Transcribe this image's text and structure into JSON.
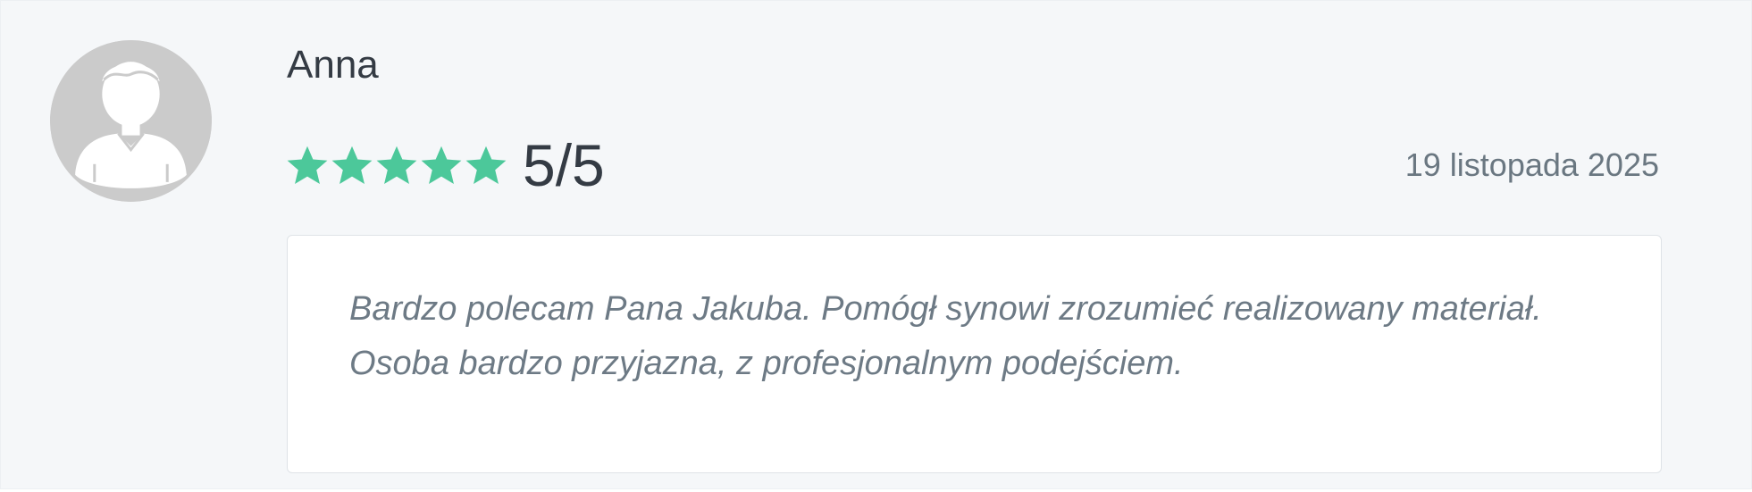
{
  "review": {
    "author": "Anna",
    "rating": {
      "value": 5,
      "max": 5,
      "label": "5/5",
      "star_color": "#4cc89a"
    },
    "date": "19 listopada 2025",
    "text_lines": [
      "Bardzo polecam Pana Jakuba. Pomógł synowi zrozumieć realizowany materiał.",
      "Osoba bardzo przyjazna, z profesjonalnym podejściem."
    ],
    "avatar_icon": "user-silhouette-icon"
  }
}
